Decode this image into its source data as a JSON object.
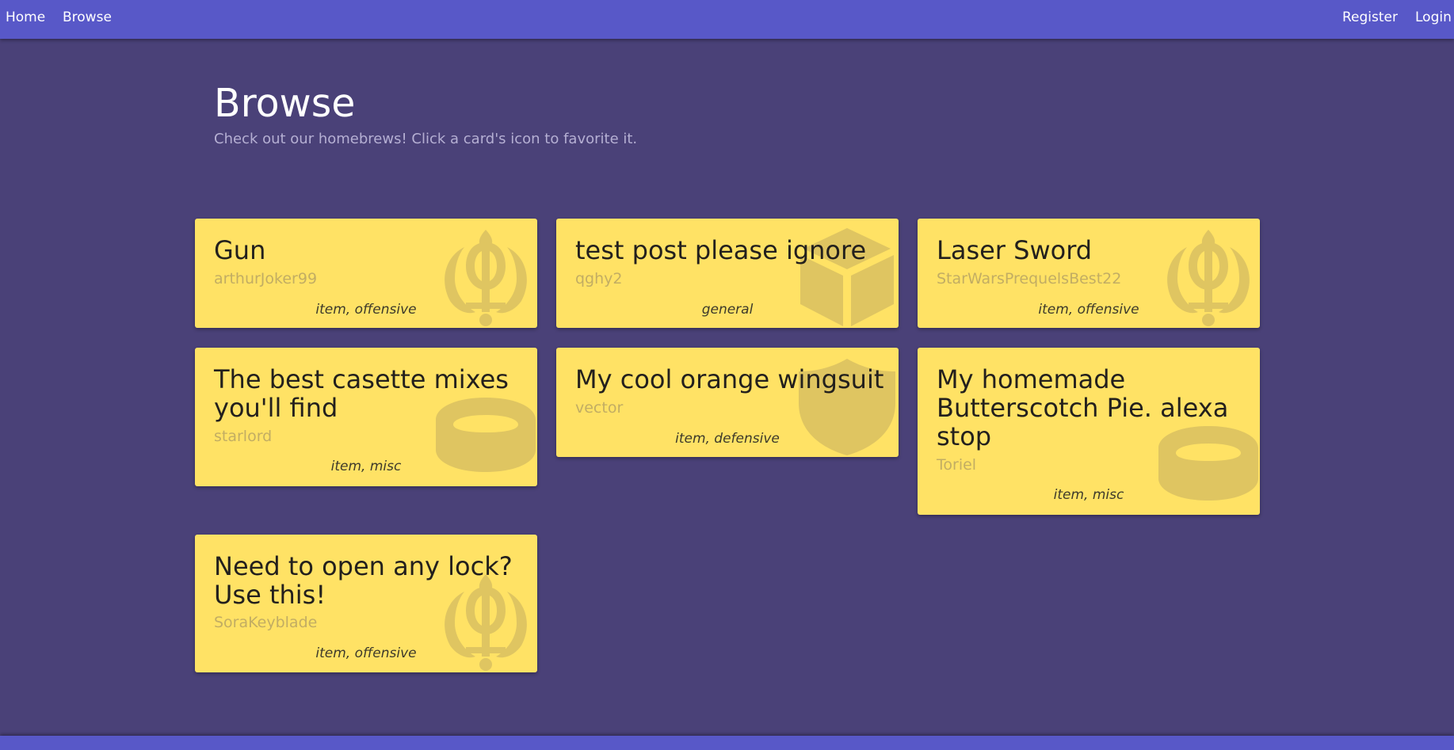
{
  "nav": {
    "left": [
      "Home",
      "Browse"
    ],
    "right": [
      "Register",
      "Login"
    ]
  },
  "header": {
    "title": "Browse",
    "subtitle": "Check out our homebrews! Click a card's icon to favorite it."
  },
  "colors": {
    "navbar": "#5858c8",
    "background": "#4a4178",
    "card": "#ffe265",
    "card_icon": "#dfc561"
  },
  "cards": [
    {
      "title": "Gun",
      "author": "arthurJoker99",
      "tags": "item, offensive",
      "icon": "khanda-icon"
    },
    {
      "title": "test post please ignore",
      "author": "qghy2",
      "tags": "general",
      "icon": "cube-icon"
    },
    {
      "title": "Laser Sword",
      "author": "StarWarsPrequelsBest22",
      "tags": "item, offensive",
      "icon": "khanda-icon"
    },
    {
      "title": "The best casette mixes you'll find",
      "author": "starlord",
      "tags": "item, misc",
      "icon": "ring-icon"
    },
    {
      "title": "My cool orange wingsuit",
      "author": "vector",
      "tags": "item, defensive",
      "icon": "shield-icon"
    },
    {
      "title": "My homemade Butterscotch Pie. alexa stop",
      "author": "Toriel",
      "tags": "item, misc",
      "icon": "ring-icon"
    },
    {
      "title": "Need to open any lock? Use this!",
      "author": "SoraKeyblade",
      "tags": "item, offensive",
      "icon": "khanda-icon"
    }
  ]
}
